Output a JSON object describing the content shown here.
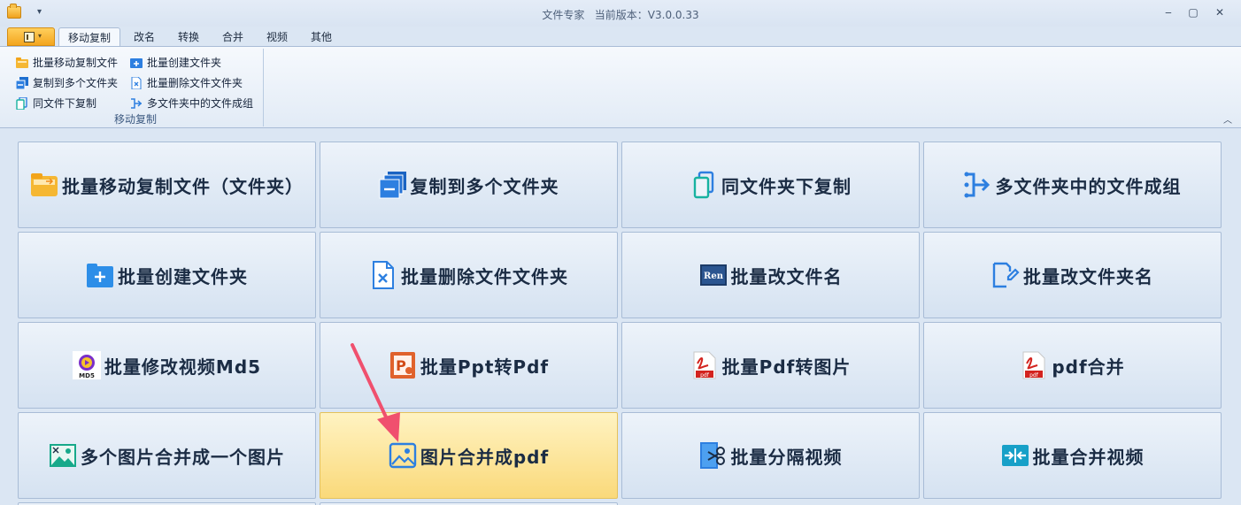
{
  "window": {
    "title": "文件专家   当前版本：V3.0.0.33",
    "qa_dropdown": "▾",
    "minimize": "‒",
    "maximize": "▢",
    "close": "✕"
  },
  "tabs": [
    {
      "label": "移动复制",
      "active": true
    },
    {
      "label": "改名"
    },
    {
      "label": "转换"
    },
    {
      "label": "合并"
    },
    {
      "label": "视频"
    },
    {
      "label": "其他"
    }
  ],
  "ribbon": {
    "group_label": "移动复制",
    "items": [
      {
        "label": "批量移动复制文件",
        "icon": "folder-move-icon"
      },
      {
        "label": "批量创建文件夹",
        "icon": "folder-add-icon"
      },
      {
        "label": "复制到多个文件夹",
        "icon": "copy-multi-icon"
      },
      {
        "label": "批量删除文件文件夹",
        "icon": "delete-file-icon"
      },
      {
        "label": "同文件下复制",
        "icon": "copy-same-icon"
      },
      {
        "label": "多文件夹中的文件成组",
        "icon": "group-icon"
      }
    ],
    "collapse": "︿"
  },
  "tiles": [
    {
      "label": "批量移动复制文件（文件夹）",
      "icon": "folder-move-icon"
    },
    {
      "label": "复制到多个文件夹",
      "icon": "copy-multi-icon"
    },
    {
      "label": "同文件夹下复制",
      "icon": "copy-same-icon"
    },
    {
      "label": "多文件夹中的文件成组",
      "icon": "group-icon"
    },
    {
      "label": "批量创建文件夹",
      "icon": "folder-add-icon"
    },
    {
      "label": "批量删除文件文件夹",
      "icon": "delete-file-icon"
    },
    {
      "label": "批量改文件名",
      "icon": "rename-icon",
      "icon_text": "Ren"
    },
    {
      "label": "批量改文件夹名",
      "icon": "rename-folder-icon"
    },
    {
      "label": "批量修改视频Md5",
      "icon": "md5-icon",
      "icon_text": "MD5"
    },
    {
      "label": "批量Ppt转Pdf",
      "icon": "ppt-icon",
      "icon_text": "P"
    },
    {
      "label": "批量Pdf转图片",
      "icon": "pdf-icon",
      "icon_text": "pdf"
    },
    {
      "label": "pdf合并",
      "icon": "pdf-icon",
      "icon_text": "pdf"
    },
    {
      "label": "多个图片合并成一个图片",
      "icon": "image-merge-icon"
    },
    {
      "label": "图片合并成pdf",
      "icon": "image-icon",
      "highlight": true
    },
    {
      "label": "批量分隔视频",
      "icon": "video-split-icon"
    },
    {
      "label": "批量合并视频",
      "icon": "video-merge-icon"
    }
  ],
  "colors": {
    "accent_blue": "#2d7fe0",
    "highlight": "#fad97a",
    "arrow": "#f0506e"
  }
}
